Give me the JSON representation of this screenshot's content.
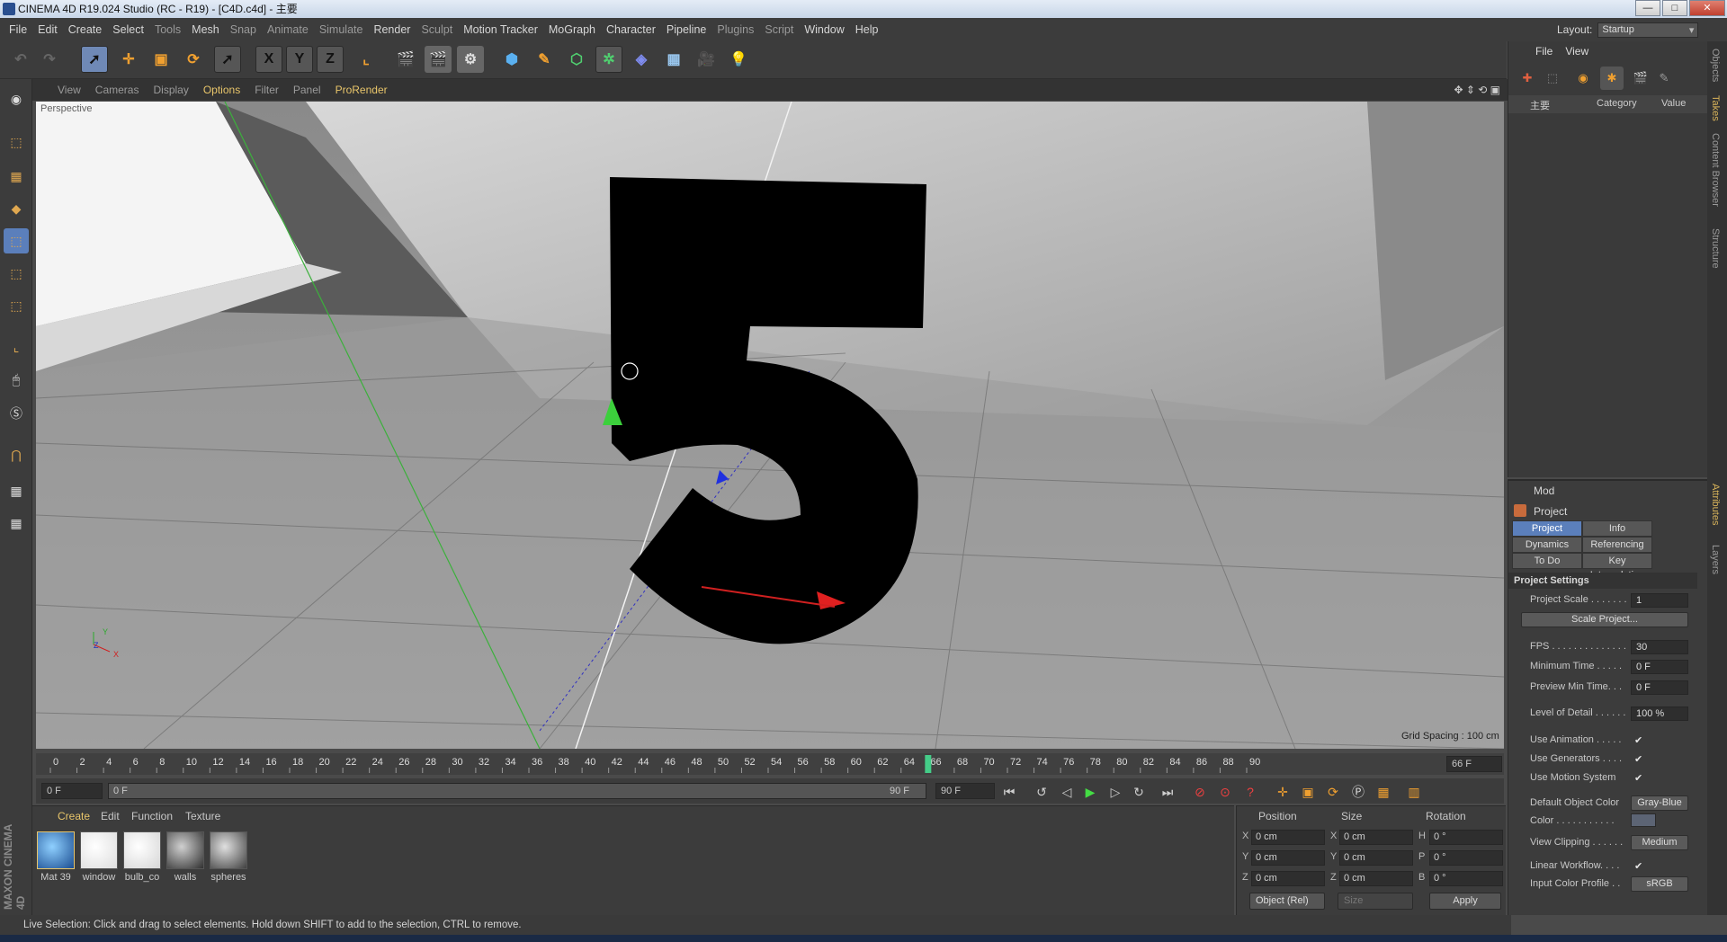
{
  "window": {
    "title": "CINEMA 4D R19.024 Studio (RC - R19) - [C4D.c4d] - 主要",
    "min": "—",
    "max": "□",
    "close": "✕"
  },
  "menus": [
    "File",
    "Edit",
    "Create",
    "Select",
    "Tools",
    "Mesh",
    "Snap",
    "Animate",
    "Simulate",
    "Render",
    "Sculpt",
    "Motion Tracker",
    "MoGraph",
    "Character",
    "Pipeline",
    "Plugins",
    "Script",
    "Window",
    "Help"
  ],
  "layout": {
    "label": "Layout:",
    "value": "Startup"
  },
  "toolbar": {
    "x_label": "X",
    "y_label": "Y",
    "z_label": "Z"
  },
  "viewport": {
    "menu": [
      "View",
      "Cameras",
      "Display",
      "Options",
      "Filter",
      "Panel",
      "ProRender"
    ],
    "active_menu": "Options",
    "camera_label": "Perspective",
    "grid_spacing": "Grid Spacing : 100 cm",
    "axis_labels": {
      "y": "Y",
      "z": "Z",
      "x": "X"
    },
    "model_glyph": "5"
  },
  "timeline": {
    "ticks": [
      "0",
      "2",
      "4",
      "6",
      "8",
      "10",
      "12",
      "14",
      "16",
      "18",
      "20",
      "22",
      "24",
      "26",
      "28",
      "30",
      "32",
      "34",
      "36",
      "38",
      "40",
      "42",
      "44",
      "46",
      "48",
      "50",
      "52",
      "54",
      "56",
      "58",
      "60",
      "62",
      "64",
      "66",
      "68",
      "70",
      "72",
      "74",
      "76",
      "78",
      "80",
      "82",
      "84",
      "86",
      "88",
      "90"
    ],
    "current_frame": 66,
    "current_label": "66 F",
    "max_frame": 90
  },
  "controls": {
    "start": "0 F",
    "range_start": "0 F",
    "range_end": "90 F",
    "end": "90 F"
  },
  "materials": {
    "tabs": [
      "Create",
      "Edit",
      "Function",
      "Texture"
    ],
    "active_tab": "Create",
    "items": [
      "Mat 39",
      "window",
      "bulb_co",
      "walls",
      "spheres"
    ]
  },
  "coordinates": {
    "headers": [
      "Position",
      "Size",
      "Rotation"
    ],
    "rows": [
      {
        "pl": "X",
        "pv": "0 cm",
        "sl": "X",
        "sv": "0 cm",
        "rl": "H",
        "rv": "0 °"
      },
      {
        "pl": "Y",
        "pv": "0 cm",
        "sl": "Y",
        "sv": "0 cm",
        "rl": "P",
        "rv": "0 °"
      },
      {
        "pl": "Z",
        "pv": "0 cm",
        "sl": "Z",
        "sv": "0 cm",
        "rl": "B",
        "rv": "0 °"
      }
    ],
    "mode": "Object (Rel)",
    "size_mode": "Size",
    "apply": "Apply"
  },
  "status": "Live Selection: Click and drag to select elements. Hold down SHIFT to add to the selection, CTRL to remove.",
  "objects": {
    "menu": [
      "File",
      "View"
    ],
    "col_name": "主要",
    "col_category": "Category",
    "col_value": "Value"
  },
  "side_tabs": [
    "Objects",
    "Takes",
    "Content Browser",
    "Structure",
    "Attributes",
    "Layers"
  ],
  "attributes": {
    "mode": "Mod",
    "object": "Project",
    "tabs": [
      "Project Settings",
      "Info",
      "Dynamics",
      "Referencing",
      "To Do",
      "Key Interpolation"
    ],
    "section": "Project Settings",
    "rows": {
      "project_scale": {
        "label": "Project Scale . . . . . . .",
        "value": "1"
      },
      "scale_project": "Scale Project...",
      "fps": {
        "label": "FPS . . . . . . . . . . . . . .",
        "value": "30"
      },
      "min_time": {
        "label": "Minimum Time . . . . .",
        "value": "0 F"
      },
      "preview_min": {
        "label": "Preview Min Time. . .",
        "value": "0 F"
      },
      "lod": {
        "label": "Level of Detail . . . . . .",
        "value": "100 %"
      },
      "use_animation": {
        "label": "Use Animation . . . . .",
        "value": "✔"
      },
      "use_generators": {
        "label": "Use Generators . . . .",
        "value": "✔"
      },
      "use_motion": {
        "label": "Use Motion System",
        "value": "✔"
      },
      "default_color": {
        "label": "Default Object Color",
        "value": "Gray-Blue"
      },
      "color": {
        "label": "Color . . . . . . . . . . ."
      },
      "view_clipping": {
        "label": "View Clipping . . . . . .",
        "value": "Medium"
      },
      "linear_workflow": {
        "label": "Linear Workflow. . . .",
        "value": "✔"
      },
      "input_profile": {
        "label": "Input Color Profile . .",
        "value": "sRGB"
      }
    }
  },
  "brand": "MAXON CINEMA 4D"
}
